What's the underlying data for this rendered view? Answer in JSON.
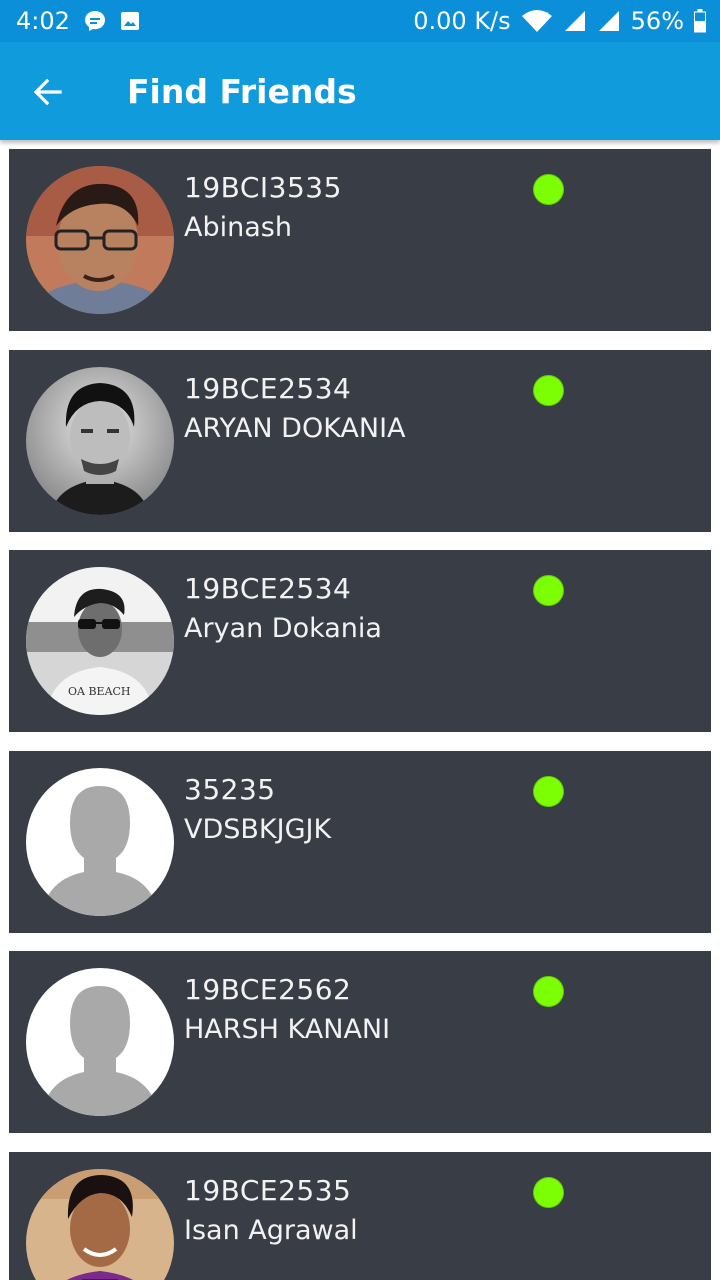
{
  "status_bar": {
    "time": "4:02",
    "net_speed": "0.00 K/s",
    "battery": "56%",
    "icons": [
      "message-icon",
      "image-icon",
      "wifi-icon",
      "signal-icon",
      "battery-icon"
    ]
  },
  "app_bar": {
    "title": "Find Friends",
    "back_icon": "arrow-left-icon"
  },
  "colors": {
    "status_bar": "#0b8fd8",
    "app_bar": "#109cdc",
    "card_bg": "#393d46",
    "online": "#7cff05",
    "text": "#f2f2f2"
  },
  "friends": [
    {
      "id": "19BCI3535",
      "name": "Abinash",
      "online": true,
      "avatar": "photo"
    },
    {
      "id": "19BCE2534",
      "name": "ARYAN DOKANIA",
      "online": true,
      "avatar": "photo"
    },
    {
      "id": "19BCE2534",
      "name": "Aryan Dokania",
      "online": true,
      "avatar": "photo"
    },
    {
      "id": "35235",
      "name": "VDSBKJGJK",
      "online": true,
      "avatar": "placeholder"
    },
    {
      "id": "19BCE2562",
      "name": "HARSH KANANI",
      "online": true,
      "avatar": "placeholder"
    },
    {
      "id": "19BCE2535",
      "name": "Isan Agrawal",
      "online": true,
      "avatar": "photo"
    }
  ]
}
